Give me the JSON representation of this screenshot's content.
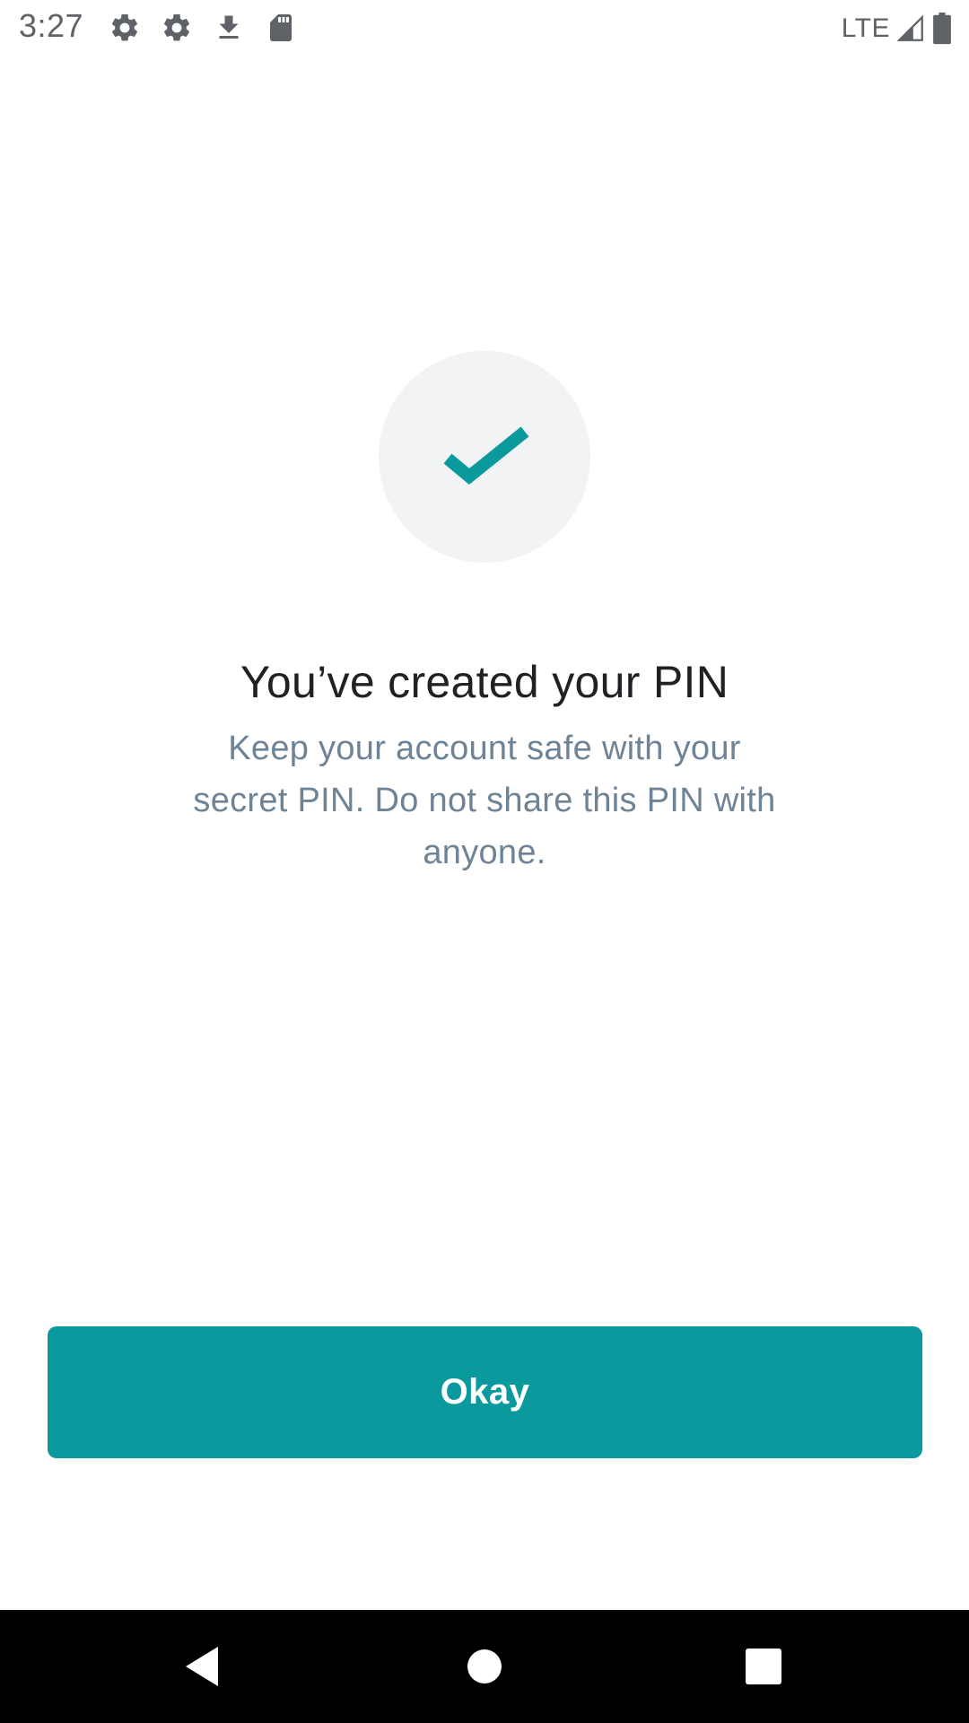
{
  "status_bar": {
    "time": "3:27",
    "network": "LTE",
    "icons": [
      "settings-icon",
      "settings-icon",
      "download-icon",
      "sd-card-icon",
      "signal-icon",
      "battery-icon"
    ]
  },
  "success": {
    "icon": "checkmark-icon",
    "accent_color": "#0a9a9e",
    "circle_color": "#f1f3f4"
  },
  "title": "You’ve created your PIN",
  "description": "Keep your account safe with your secret PIN. Do not share this PIN with anyone.",
  "okay_button": {
    "label": "Okay",
    "color": "#0a9a9e"
  },
  "nav_bar": {
    "icons": [
      "back-icon",
      "home-icon",
      "recents-icon"
    ]
  }
}
